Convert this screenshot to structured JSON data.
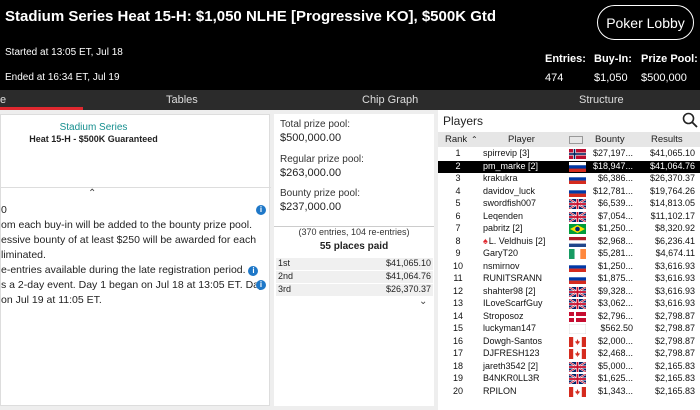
{
  "header": {
    "title": "Stadium Series Heat 15-H: $1,050 NLHE [Progressive KO], $500K Gtd",
    "lobby_button": "Poker Lobby",
    "started": "Started at 13:05 ET, Jul 18",
    "ended": "Ended at 16:34 ET, Jul 19",
    "entries_label": "Entries:",
    "entries_value": "474",
    "buyin_label": "Buy-In:",
    "buyin_value": "$1,050",
    "prizepool_label": "Prize Pool:",
    "prizepool_value": "$500,000"
  },
  "tabs": [
    {
      "label": "e",
      "active": true
    },
    {
      "label": "Tables"
    },
    {
      "label": "Chip Graph"
    },
    {
      "label": "Structure"
    }
  ],
  "info": {
    "series": "Stadium Series",
    "event": "Heat 15-H - $500K Guaranteed",
    "desc_lines": [
      "0",
      "om each buy-in will be added to the bounty prize pool.",
      "essive bounty of at least $250 will be awarded for each",
      "liminated.",
      "e-entries available during the late registration period.",
      "s a 2-day event. Day 1 began on Jul 18 at 13:05 ET. Day",
      "on Jul 19 at 11:05 ET."
    ]
  },
  "prize": {
    "total_label": "Total prize pool:",
    "total_value": "$500,000.00",
    "regular_label": "Regular prize pool:",
    "regular_value": "$263,000.00",
    "bounty_label": "Bounty prize pool:",
    "bounty_value": "$237,000.00",
    "entries_note": "(370 entries, 104 re-entries)",
    "places_paid": "55 places paid",
    "payouts": [
      {
        "place": "1st",
        "amount": "$41,065.10"
      },
      {
        "place": "2nd",
        "amount": "$41,064.76"
      },
      {
        "place": "3rd",
        "amount": "$26,370.37"
      }
    ]
  },
  "players": {
    "title": "Players",
    "headers": {
      "rank": "Rank",
      "player": "Player",
      "bounty": "Bounty",
      "results": "Results"
    },
    "rows": [
      {
        "rank": "1",
        "name": "spirrevip [3]",
        "flag": "no",
        "bounty": "$27,197...",
        "result": "$41,065.10"
      },
      {
        "rank": "2",
        "name": "pm_marke [2]",
        "flag": "ru",
        "bounty": "$18,947...",
        "result": "$41,064.76",
        "selected": true
      },
      {
        "rank": "3",
        "name": "krakukra",
        "flag": "ru",
        "bounty": "$6,386...",
        "result": "$26,370.37"
      },
      {
        "rank": "4",
        "name": "davidov_luck",
        "flag": "ru",
        "bounty": "$12,781...",
        "result": "$19,764.26"
      },
      {
        "rank": "5",
        "name": "swordfish007",
        "flag": "gb",
        "bounty": "$6,539...",
        "result": "$14,813.05"
      },
      {
        "rank": "6",
        "name": "Leqenden",
        "flag": "gb",
        "bounty": "$7,054...",
        "result": "$11,102.17"
      },
      {
        "rank": "7",
        "name": "pabritz [2]",
        "flag": "br",
        "bounty": "$1,250...",
        "result": "$8,320.92"
      },
      {
        "rank": "8",
        "name": "L. Veldhuis [2]",
        "flag": "nl",
        "bounty": "$2,968...",
        "result": "$6,236.41",
        "pro": true
      },
      {
        "rank": "9",
        "name": "GaryT20",
        "flag": "ie",
        "bounty": "$5,281...",
        "result": "$4,674.11"
      },
      {
        "rank": "10",
        "name": "nsmirnov",
        "flag": "ru",
        "bounty": "$1,250...",
        "result": "$3,616.93"
      },
      {
        "rank": "11",
        "name": "RUNITSRANN",
        "flag": "ru",
        "bounty": "$1,875...",
        "result": "$3,616.93"
      },
      {
        "rank": "12",
        "name": "shahter98 [2]",
        "flag": "gb",
        "bounty": "$9,328...",
        "result": "$3,616.93"
      },
      {
        "rank": "13",
        "name": "ILoveScarfGuy",
        "flag": "gb",
        "bounty": "$3,062...",
        "result": "$3,616.93"
      },
      {
        "rank": "14",
        "name": "Stroposoz",
        "flag": "dk",
        "bounty": "$2,796...",
        "result": "$2,798.87"
      },
      {
        "rank": "15",
        "name": "luckyman147",
        "flag": "wh",
        "bounty": "$562.50",
        "result": "$2,798.87"
      },
      {
        "rank": "16",
        "name": "Dowgh-Santos",
        "flag": "ca",
        "bounty": "$2,000...",
        "result": "$2,798.87"
      },
      {
        "rank": "17",
        "name": "DJFRESH123",
        "flag": "ca",
        "bounty": "$2,468...",
        "result": "$2,798.87"
      },
      {
        "rank": "18",
        "name": "jareth3542 [2]",
        "flag": "gb",
        "bounty": "$5,000...",
        "result": "$2,165.83"
      },
      {
        "rank": "19",
        "name": "B4NKR0LL3R",
        "flag": "gb",
        "bounty": "$1,625...",
        "result": "$2,165.83"
      },
      {
        "rank": "20",
        "name": "RPILON",
        "flag": "ca",
        "bounty": "$1,343...",
        "result": "$2,165.83"
      }
    ]
  },
  "colors": {
    "accent_red": "#e0282f",
    "teal": "#168f8f",
    "info_blue": "#1f78c8"
  }
}
